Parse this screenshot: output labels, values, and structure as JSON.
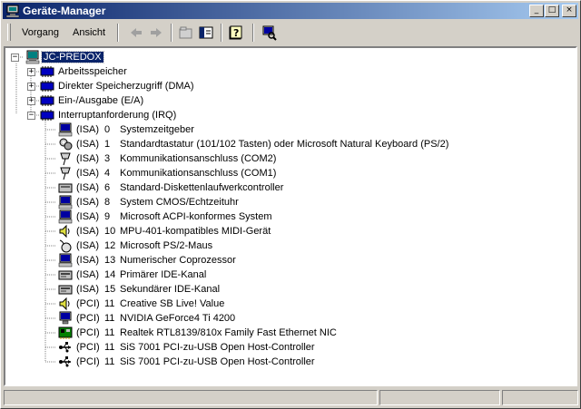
{
  "window": {
    "title": "Geräte-Manager",
    "controls": {
      "minimize": "_",
      "maximize": "□",
      "close": "×"
    }
  },
  "menu": {
    "items": [
      {
        "label": "Vorgang"
      },
      {
        "label": "Ansicht"
      }
    ]
  },
  "toolbar": {
    "buttons": [
      "back-arrow-icon",
      "forward-arrow-icon",
      "properties-icon",
      "console-tree-icon",
      "help-icon",
      "scan-hardware-icon"
    ]
  },
  "tree": {
    "root": {
      "label": "JC-PREDOX",
      "icon": "computer-icon"
    },
    "categories": [
      {
        "label": "Arbeitsspeicher",
        "expanded": false,
        "icon": "memory-chip-icon"
      },
      {
        "label": "Direkter Speicherzugriff (DMA)",
        "expanded": false,
        "icon": "memory-chip-icon"
      },
      {
        "label": "Ein-/Ausgabe (E/A)",
        "expanded": false,
        "icon": "memory-chip-icon"
      },
      {
        "label": "Interruptanforderung (IRQ)",
        "expanded": true,
        "icon": "memory-chip-icon"
      }
    ],
    "irq": [
      {
        "bus": "(ISA)",
        "num": "0",
        "device": "Systemzeitgeber",
        "icon": "system-device-icon"
      },
      {
        "bus": "(ISA)",
        "num": "1",
        "device": "Standardtastatur (101/102 Tasten) oder Microsoft Natural Keyboard (PS/2)",
        "icon": "keyboard-icon"
      },
      {
        "bus": "(ISA)",
        "num": "3",
        "device": "Kommunikationsanschluss (COM2)",
        "icon": "port-icon"
      },
      {
        "bus": "(ISA)",
        "num": "4",
        "device": "Kommunikationsanschluss (COM1)",
        "icon": "port-icon"
      },
      {
        "bus": "(ISA)",
        "num": "6",
        "device": "Standard-Diskettenlaufwerkcontroller",
        "icon": "floppy-controller-icon"
      },
      {
        "bus": "(ISA)",
        "num": "8",
        "device": "System CMOS/Echtzeituhr",
        "icon": "system-device-icon"
      },
      {
        "bus": "(ISA)",
        "num": "9",
        "device": "Microsoft ACPI-konformes System",
        "icon": "system-device-icon"
      },
      {
        "bus": "(ISA)",
        "num": "10",
        "device": "MPU-401-kompatibles MIDI-Gerät",
        "icon": "speaker-icon"
      },
      {
        "bus": "(ISA)",
        "num": "12",
        "device": "Microsoft PS/2-Maus",
        "icon": "mouse-icon"
      },
      {
        "bus": "(ISA)",
        "num": "13",
        "device": "Numerischer Coprozessor",
        "icon": "system-device-icon"
      },
      {
        "bus": "(ISA)",
        "num": "14",
        "device": "Primärer IDE-Kanal",
        "icon": "ide-controller-icon"
      },
      {
        "bus": "(ISA)",
        "num": "15",
        "device": "Sekundärer IDE-Kanal",
        "icon": "ide-controller-icon"
      },
      {
        "bus": "(PCI)",
        "num": "11",
        "device": "Creative SB Live! Value",
        "icon": "speaker-icon"
      },
      {
        "bus": "(PCI)",
        "num": "11",
        "device": "NVIDIA GeForce4 Ti 4200",
        "icon": "display-adapter-icon"
      },
      {
        "bus": "(PCI)",
        "num": "11",
        "device": "Realtek RTL8139/810x Family Fast Ethernet NIC",
        "icon": "network-card-icon"
      },
      {
        "bus": "(PCI)",
        "num": "11",
        "device": "SiS 7001 PCI-zu-USB Open Host-Controller",
        "icon": "usb-icon"
      },
      {
        "bus": "(PCI)",
        "num": "11",
        "device": "SiS 7001 PCI-zu-USB Open Host-Controller",
        "icon": "usb-icon"
      }
    ]
  },
  "colors": {
    "titlebar_start": "#0a246a",
    "titlebar_end": "#a6caf0",
    "face": "#d4d0c8",
    "selection": "#0a246a"
  }
}
